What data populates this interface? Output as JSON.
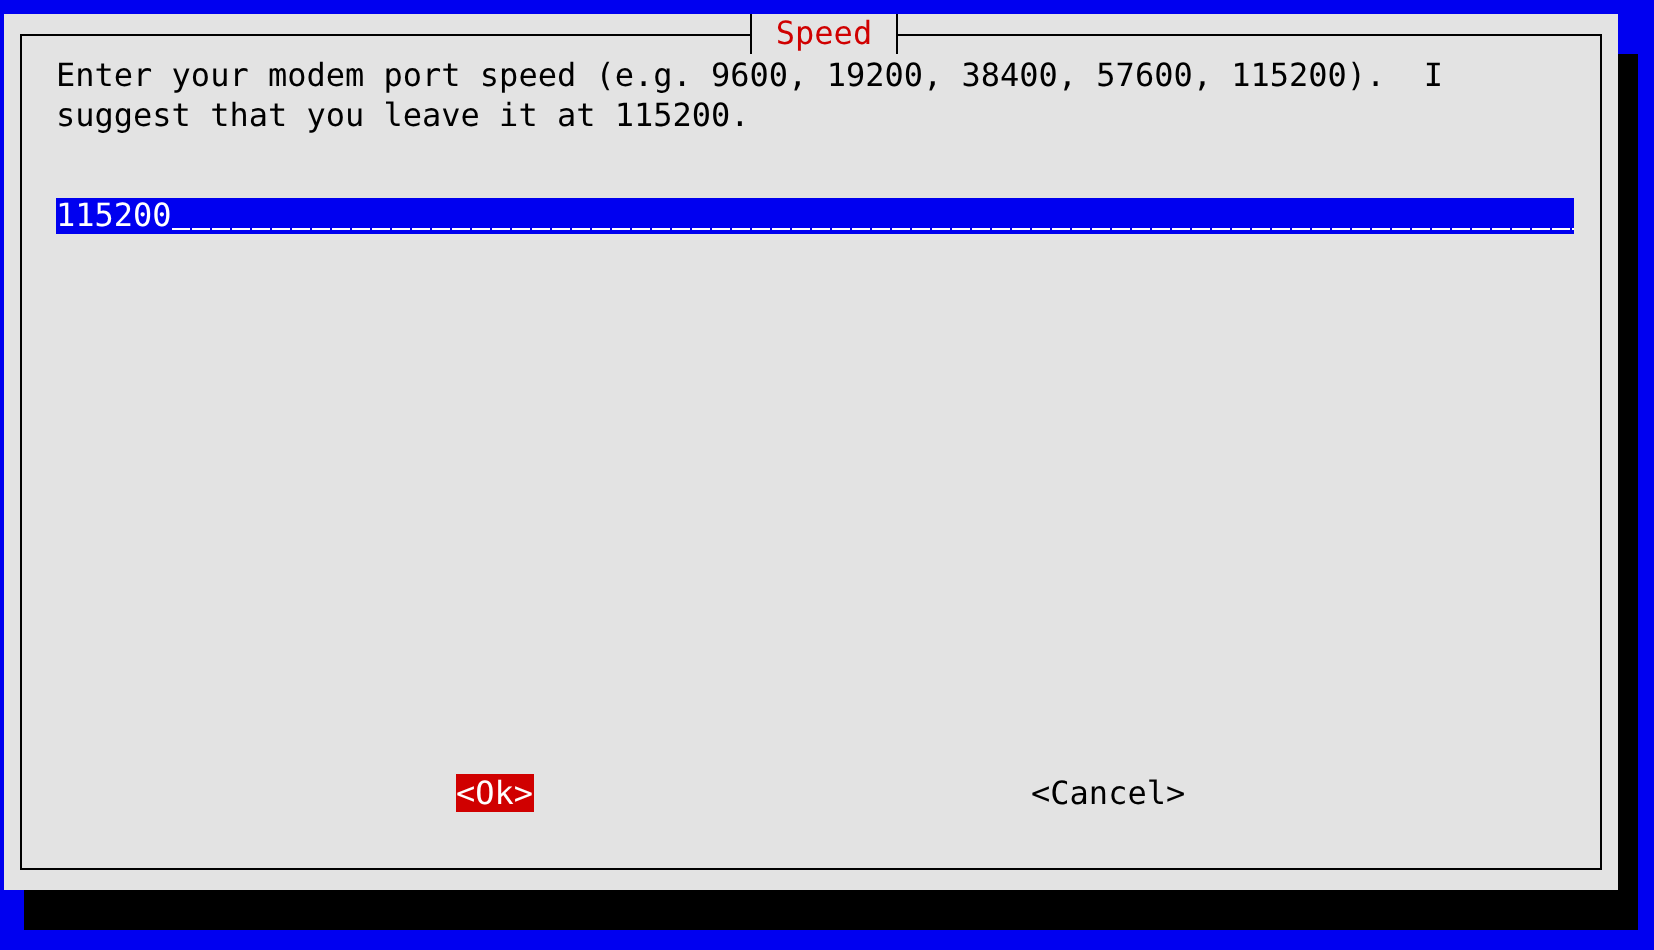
{
  "dialog": {
    "title": "Speed",
    "prompt": "Enter your modem port speed (e.g. 9600, 19200, 38400, 57600, 115200).  I suggest that you leave it at 115200.",
    "input": {
      "value": "115200"
    },
    "buttons": [
      {
        "label": "<Ok>",
        "selected": true
      },
      {
        "label": "<Cancel>",
        "selected": false
      }
    ]
  }
}
